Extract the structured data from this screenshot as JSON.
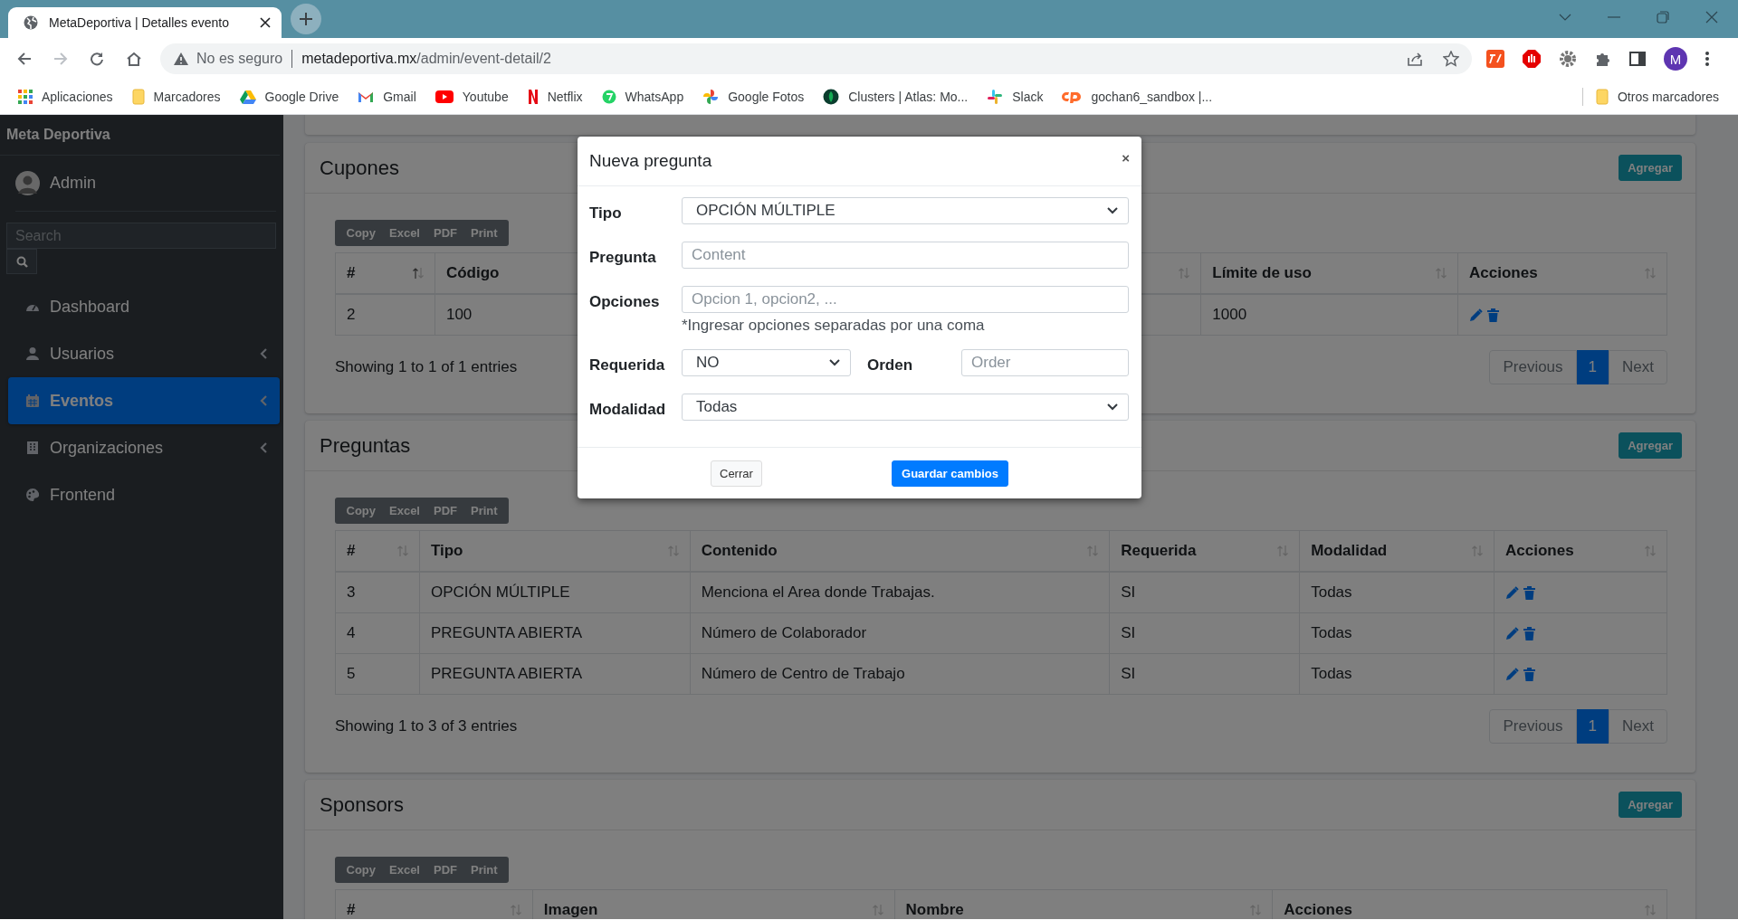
{
  "browser": {
    "tab": {
      "title": "MetaDeportiva | Detalles evento"
    },
    "address": {
      "security": "No es seguro",
      "host": "metadeportiva.mx",
      "path": "/admin/event-detail/2"
    },
    "profile": {
      "initial": "M"
    },
    "bookmarks": [
      {
        "label": "Aplicaciones",
        "kind": "apps"
      },
      {
        "label": "Marcadores",
        "kind": "folder"
      },
      {
        "label": "Google Drive",
        "kind": "drive"
      },
      {
        "label": "Gmail",
        "kind": "mail"
      },
      {
        "label": "Youtube",
        "kind": "video"
      },
      {
        "label": "Netflix",
        "kind": "letter"
      },
      {
        "label": "WhatsApp",
        "kind": "chat"
      },
      {
        "label": "Google Fotos",
        "kind": "pinwheel"
      },
      {
        "label": "Clusters | Atlas: Mo...",
        "kind": "leaf"
      },
      {
        "label": "Slack",
        "kind": "hash"
      },
      {
        "label": "gochan6_sandbox |...",
        "kind": "cp"
      }
    ],
    "other_bookmarks": {
      "label": "Otros marcadores",
      "kind": "folder"
    }
  },
  "sidebar": {
    "brand": "Meta Deportiva",
    "user": {
      "name": "Admin"
    },
    "search": {
      "placeholder": "Search"
    },
    "items": [
      {
        "label": "Dashboard",
        "kind": "gauge",
        "selected": false,
        "submenu": false
      },
      {
        "label": "Usuarios",
        "kind": "user",
        "selected": false,
        "submenu": true
      },
      {
        "label": "Eventos",
        "kind": "calendar",
        "selected": true,
        "submenu": true
      },
      {
        "label": "Organizaciones",
        "kind": "building",
        "selected": false,
        "submenu": true
      },
      {
        "label": "Frontend",
        "kind": "palette",
        "selected": false,
        "submenu": false
      }
    ]
  },
  "cards": [
    {
      "title": "Cupones",
      "add_button": "Agregar",
      "export_buttons": [
        "Copy",
        "Excel",
        "PDF",
        "Print"
      ],
      "table": {
        "columns": [
          {
            "label": "#",
            "kind": "text",
            "sorted": true
          },
          {
            "label": "Código",
            "kind": "text",
            "sorted": false
          },
          {
            "label": "Límite de uso",
            "kind": "text",
            "sorted": false
          },
          {
            "label": "Acciones",
            "kind": "actions",
            "sorted": false
          }
        ],
        "rows": [
          {
            "cells": [
              "2",
              "100",
              "1000"
            ]
          }
        ]
      },
      "info": "Showing 1 to 1 of 1 entries",
      "pagination": {
        "previous": "Previous",
        "pages": [
          {
            "label": "1",
            "selected": true
          }
        ],
        "next": "Next"
      }
    },
    {
      "title": "Preguntas",
      "add_button": "Agregar",
      "export_buttons": [
        "Copy",
        "Excel",
        "PDF",
        "Print"
      ],
      "table": {
        "columns": [
          {
            "label": "#",
            "kind": "text",
            "sorted": false
          },
          {
            "label": "Tipo",
            "kind": "text",
            "sorted": false
          },
          {
            "label": "Contenido",
            "kind": "text",
            "sorted": false
          },
          {
            "label": "Requerida",
            "kind": "text",
            "sorted": false
          },
          {
            "label": "Modalidad",
            "kind": "text",
            "sorted": false
          },
          {
            "label": "Acciones",
            "kind": "actions",
            "sorted": false
          }
        ],
        "rows": [
          {
            "cells": [
              "3",
              "OPCIÓN MÚLTIPLE",
              "Menciona el Area donde Trabajas.",
              "SI",
              "Todas"
            ]
          },
          {
            "cells": [
              "4",
              "PREGUNTA ABIERTA",
              "Número de Colaborador",
              "SI",
              "Todas"
            ]
          },
          {
            "cells": [
              "5",
              "PREGUNTA ABIERTA",
              "Número de Centro de Trabajo",
              "SI",
              "Todas"
            ]
          }
        ]
      },
      "info": "Showing 1 to 3 of 3 entries",
      "pagination": {
        "previous": "Previous",
        "pages": [
          {
            "label": "1",
            "selected": true
          }
        ],
        "next": "Next"
      }
    },
    {
      "title": "Sponsors",
      "add_button": "Agregar",
      "export_buttons": [
        "Copy",
        "Excel",
        "PDF",
        "Print"
      ],
      "table": {
        "columns": [
          {
            "label": "#",
            "sorted": false
          },
          {
            "label": "Imagen",
            "sorted": false
          },
          {
            "label": "Nombre",
            "sorted": false
          },
          {
            "label": "Acciones",
            "sorted": false
          }
        ]
      }
    }
  ],
  "modal": {
    "title": "Nueva pregunta",
    "close": "×",
    "rows": [
      {
        "fields": [
          {
            "kind": "select",
            "label": "Tipo",
            "value": "OPCIÓN MÚLTIPLE"
          }
        ]
      },
      {
        "fields": [
          {
            "kind": "input",
            "label": "Pregunta",
            "placeholder": "Content"
          }
        ]
      },
      {
        "fields": [
          {
            "kind": "input",
            "label": "Opciones",
            "placeholder": "Opcion 1, opcion2, ...",
            "help": "*Ingresar opciones separadas por una coma"
          }
        ]
      },
      {
        "fields": [
          {
            "kind": "select",
            "label": "Requerida",
            "value": "NO"
          },
          {
            "kind": "input",
            "label": "Orden",
            "placeholder": "Order"
          }
        ]
      },
      {
        "fields": [
          {
            "kind": "select",
            "label": "Modalidad",
            "value": "Todas"
          }
        ]
      }
    ],
    "buttons": [
      {
        "label": "Cerrar",
        "kind": "secondary"
      },
      {
        "label": "Guardar cambios",
        "kind": "primary"
      }
    ]
  }
}
